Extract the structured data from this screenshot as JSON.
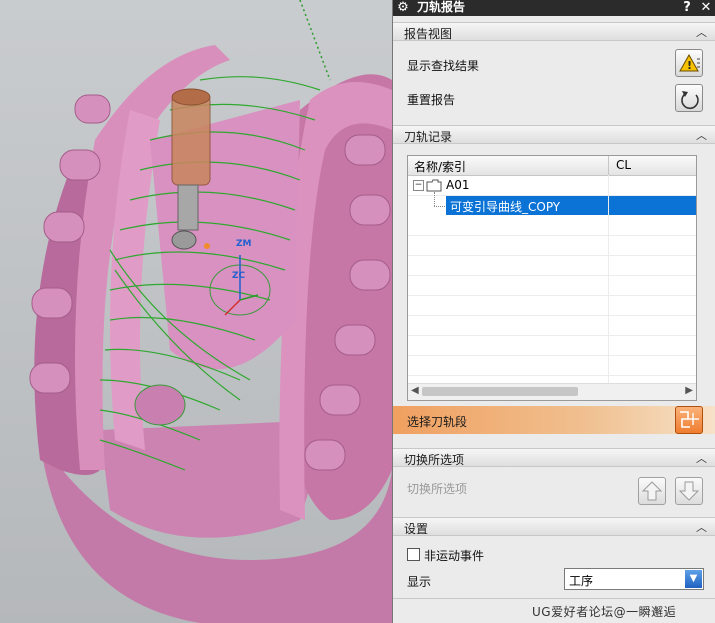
{
  "dialog": {
    "title": "刀轨报告",
    "help_glyph": "?",
    "close_glyph": "✕"
  },
  "sections": {
    "report_view": {
      "title": "报告视图",
      "show_results_label": "显示查找结果",
      "reset_report_label": "重置报告"
    },
    "toolpath_record": {
      "title": "刀轨记录",
      "columns": [
        "名称/索引",
        "CL"
      ],
      "tree": {
        "root": "A01",
        "child": "可变引导曲线_COPY"
      },
      "select_segment_label": "选择刀轨段"
    },
    "switch_options": {
      "title": "切换所选项",
      "label": "切换所选项"
    },
    "settings": {
      "title": "设置",
      "non_motion_events_label": "非运动事件",
      "non_motion_events_checked": false,
      "display_label": "显示",
      "display_value": "工序"
    }
  },
  "watermark": "UG爱好者论坛@一瞬邂逅",
  "colors": {
    "part": "#d68ab8",
    "toolpath": "#2fa82f",
    "selection": "#0b73d6",
    "select_band": "#f0a060"
  }
}
